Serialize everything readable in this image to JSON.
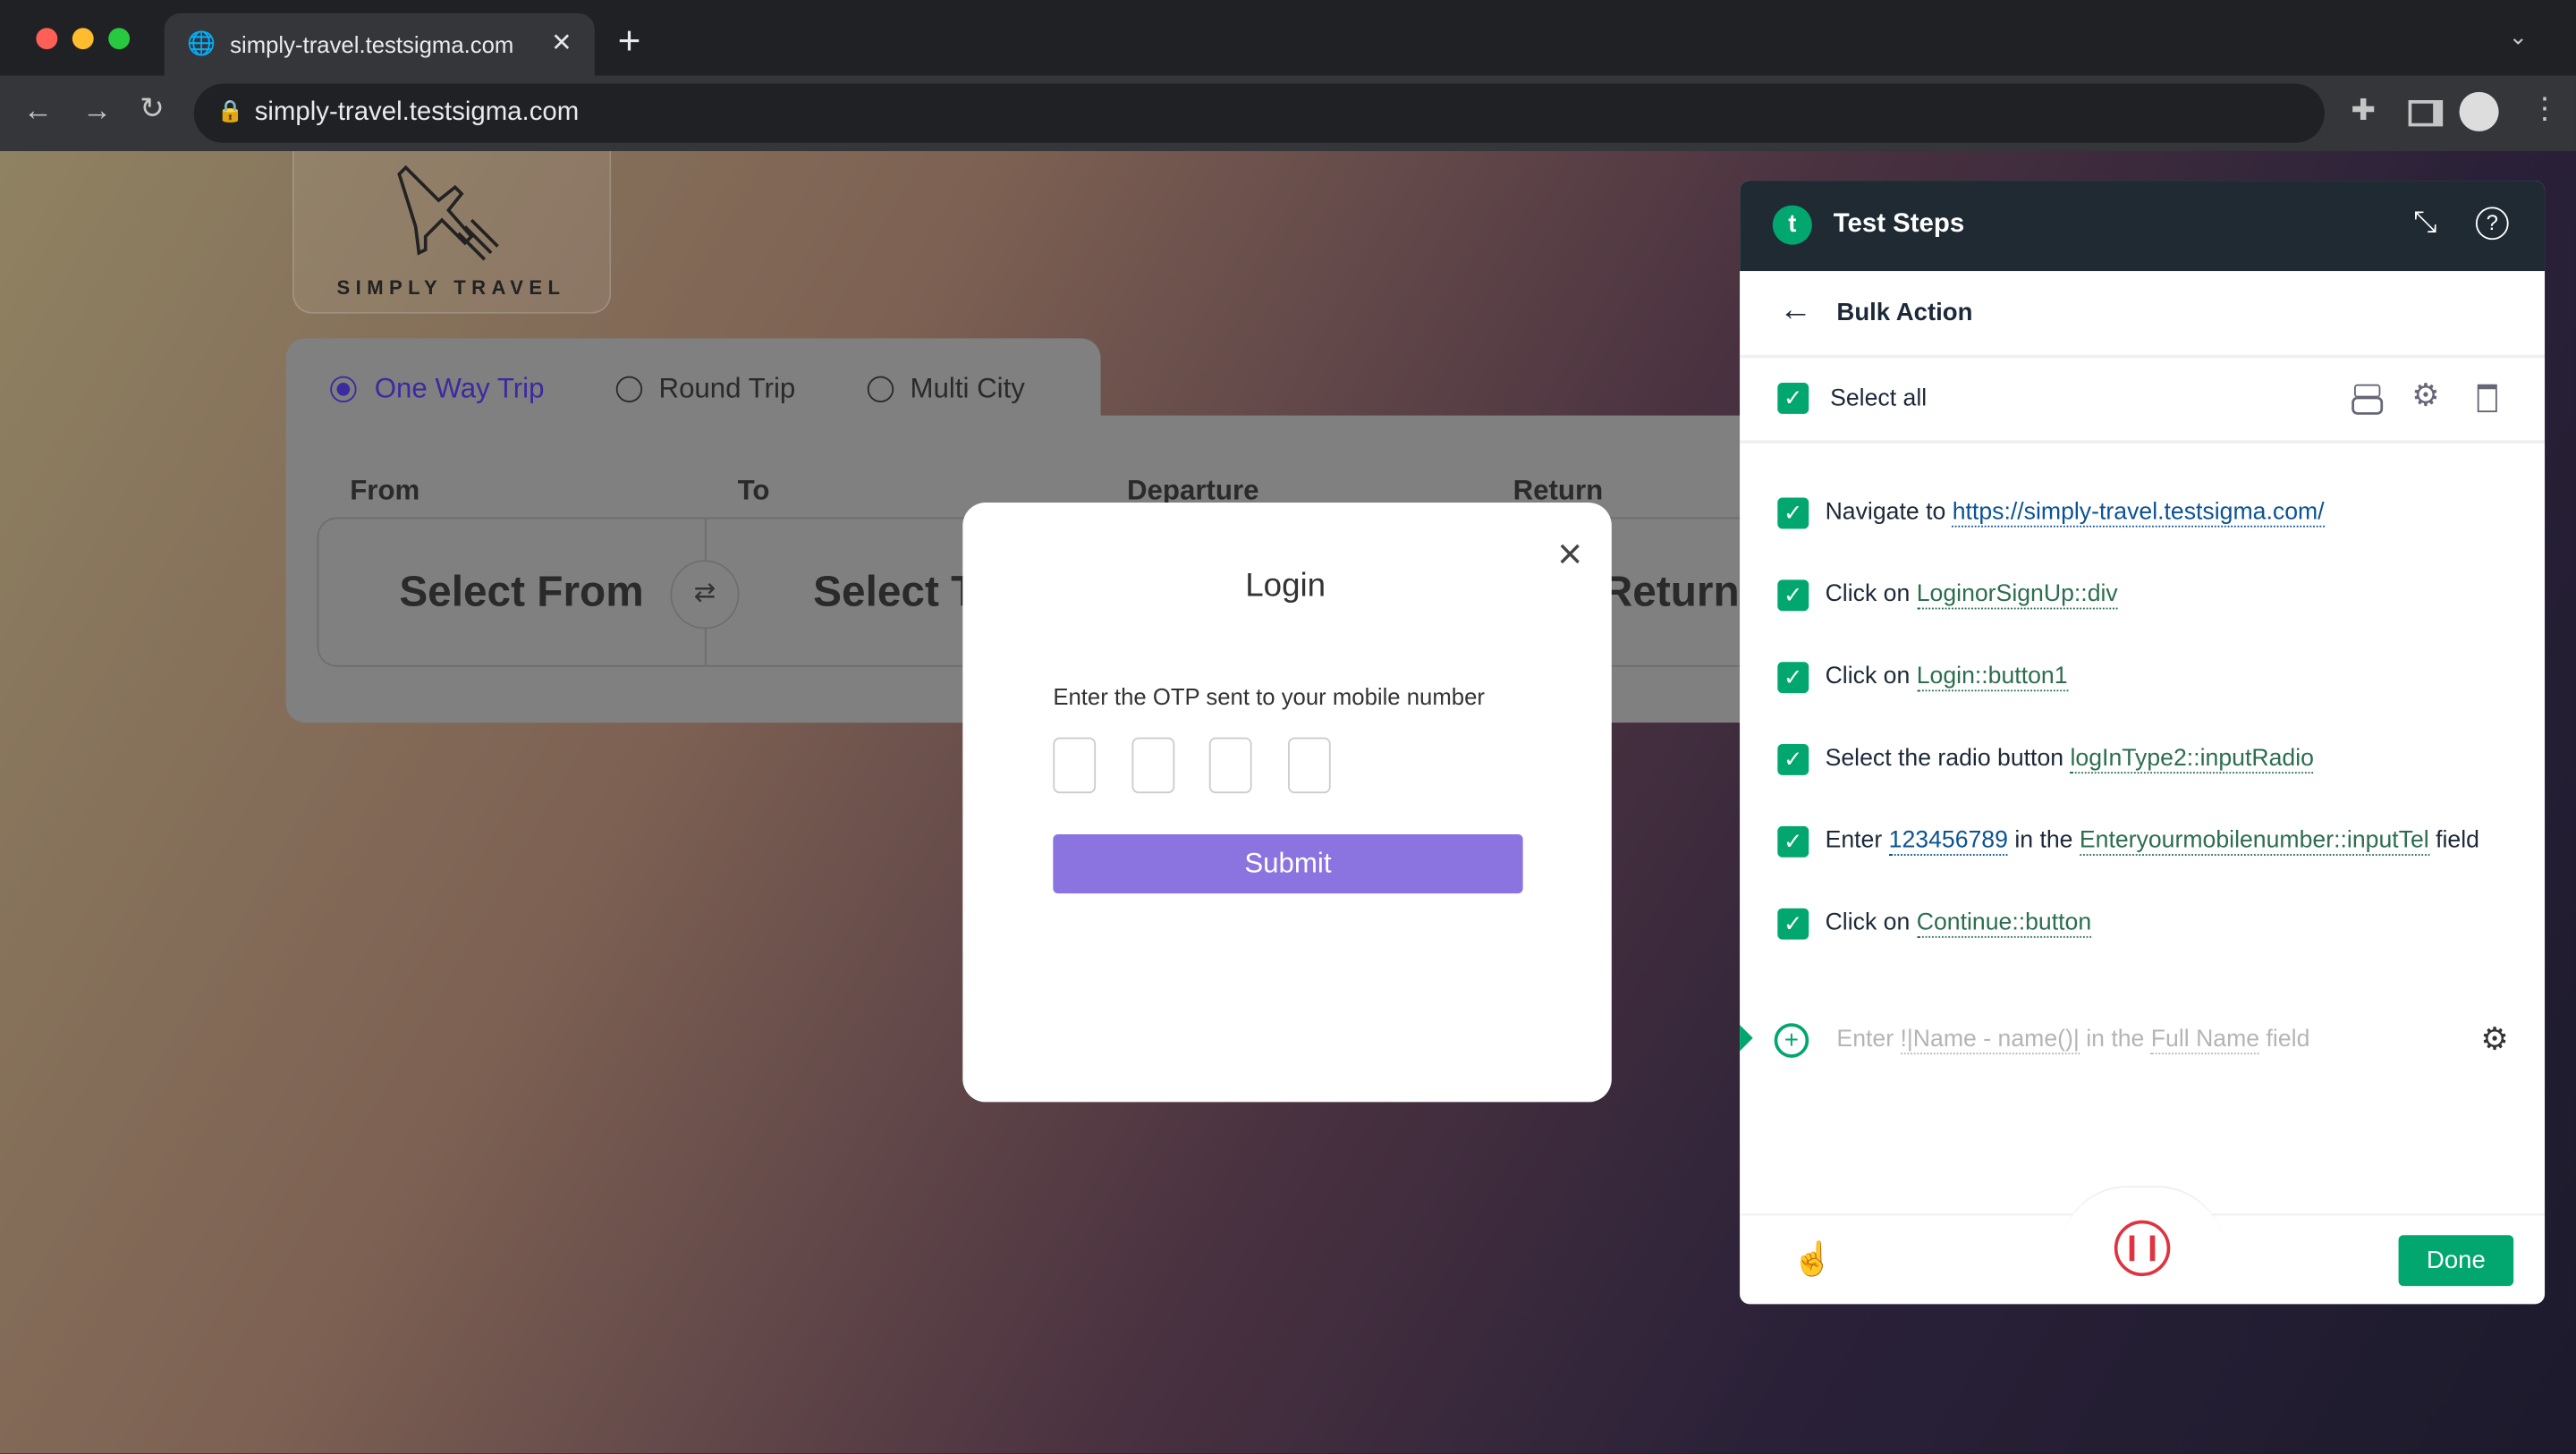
{
  "browser": {
    "tab_title": "simply-travel.testsigma.com",
    "url": "simply-travel.testsigma.com",
    "new_tab": "+",
    "close_tab": "×"
  },
  "site": {
    "logo_text": "SIMPLY TRAVEL",
    "trip_types": [
      {
        "label": "One Way Trip",
        "selected": true
      },
      {
        "label": "Round Trip",
        "selected": false
      },
      {
        "label": "Multi City",
        "selected": false
      }
    ],
    "fields": {
      "from": "From",
      "to": "To",
      "departure": "Departure",
      "return": "Return"
    },
    "select_from": "Select From",
    "select_to": "Select To",
    "return_value": "Return",
    "swap_icon": "⇄"
  },
  "modal": {
    "title": "Login",
    "instruction": "Enter the OTP sent to your mobile number",
    "otp_digits": [
      "",
      "",
      "",
      ""
    ],
    "submit_label": "Submit",
    "close": "×",
    "accent": "#8b74e0"
  },
  "panel": {
    "title": "Test Steps",
    "subtitle": "Bulk Action",
    "select_all": "Select all",
    "steps": [
      {
        "prefix": "Navigate to ",
        "parts": [
          {
            "text": "https://simply-travel.testsigma.com/",
            "type": "test-data"
          }
        ]
      },
      {
        "prefix": "Click on ",
        "parts": [
          {
            "text": "LoginorSignUp::div",
            "type": "element"
          }
        ]
      },
      {
        "prefix": "Click on ",
        "parts": [
          {
            "text": "Login::button1",
            "type": "element"
          }
        ]
      },
      {
        "prefix": "Select the radio button ",
        "parts": [
          {
            "text": "logInType2::inputRadio",
            "type": "element"
          }
        ]
      },
      {
        "prefix": "Enter ",
        "value": "123456789",
        "middle": " in the ",
        "element": "Enteryourmobilenumber::inputTel",
        "suffix": " field"
      },
      {
        "prefix": "Click on ",
        "parts": [
          {
            "text": "Continue::button",
            "type": "element"
          }
        ]
      }
    ],
    "new_step": {
      "prefix": "Enter ",
      "value": "!|Name - name()|",
      "middle": " in the ",
      "element": "Full Name",
      "suffix": " field"
    },
    "done_label": "Done",
    "colors": {
      "header": "#1f2a33",
      "green": "#01a76f",
      "pause": "#e0323f"
    }
  }
}
